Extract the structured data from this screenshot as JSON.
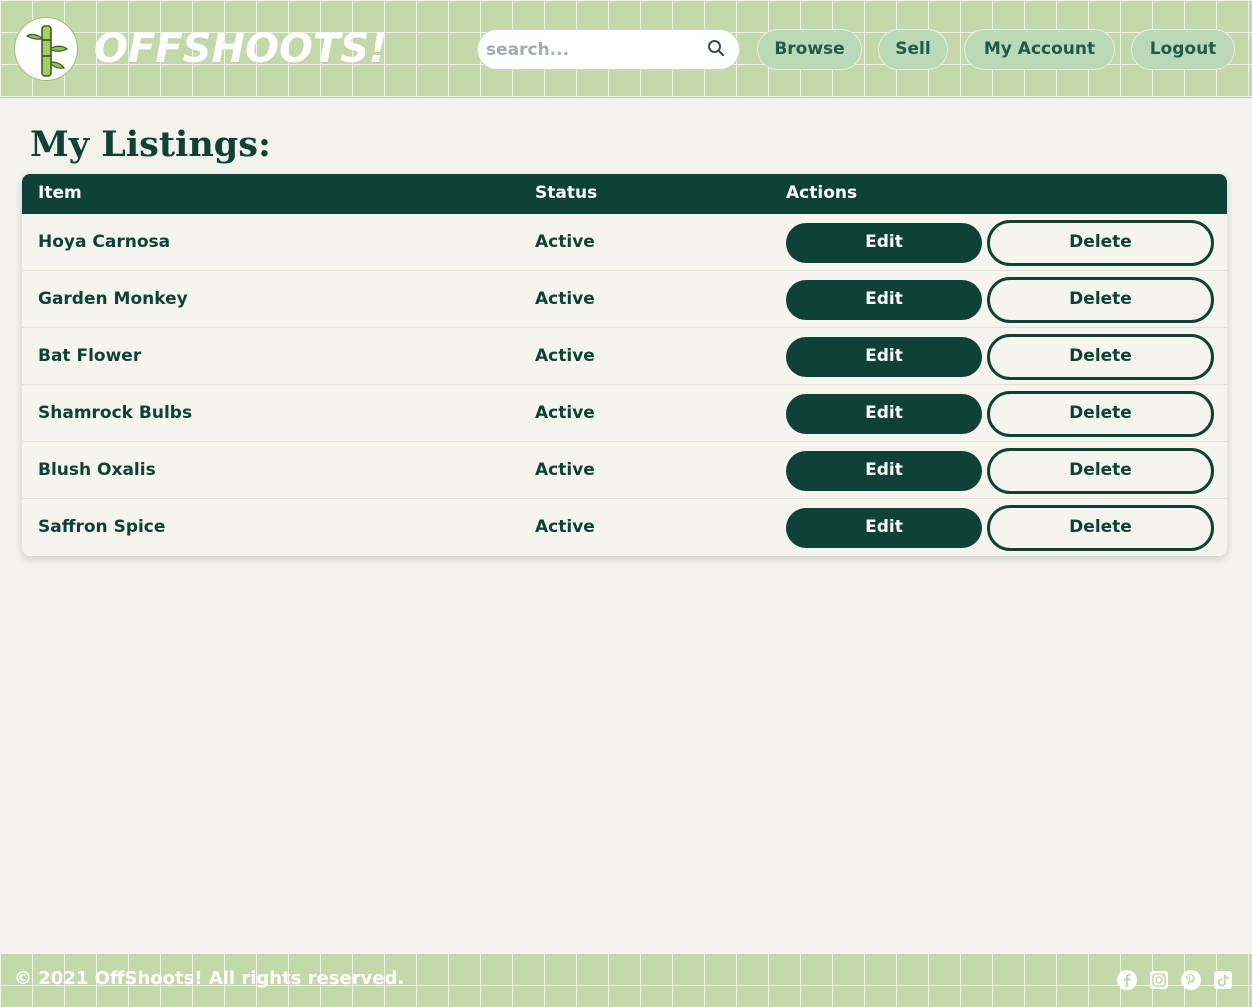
{
  "header": {
    "brand": "OFFSHOOTS!",
    "logo_icon": "bamboo-icon",
    "search_placeholder": "search...",
    "search_icon": "search-icon",
    "nav": {
      "browse": "Browse",
      "sell": "Sell",
      "my_account": "My Account",
      "logout": "Logout"
    }
  },
  "main": {
    "title": "My Listings:",
    "columns": {
      "item": "Item",
      "status": "Status",
      "actions": "Actions"
    },
    "edit_label": "Edit",
    "delete_label": "Delete",
    "rows": [
      {
        "item": "Hoya Carnosa",
        "status": "Active"
      },
      {
        "item": "Garden Monkey",
        "status": "Active"
      },
      {
        "item": "Bat Flower",
        "status": "Active"
      },
      {
        "item": "Shamrock Bulbs",
        "status": "Active"
      },
      {
        "item": "Blush Oxalis",
        "status": "Active"
      },
      {
        "item": "Saffron Spice",
        "status": "Active"
      }
    ]
  },
  "footer": {
    "copyright": "© 2021 OffShoots! All rights reserved.",
    "social_icons": [
      "facebook-icon",
      "instagram-icon",
      "pinterest-icon",
      "tiktok-icon"
    ]
  },
  "colors": {
    "accent_dark": "#0e4236",
    "header_green": "#c3d9a9",
    "nav_button": "#bad9b6",
    "background": "#f3f2ec"
  }
}
